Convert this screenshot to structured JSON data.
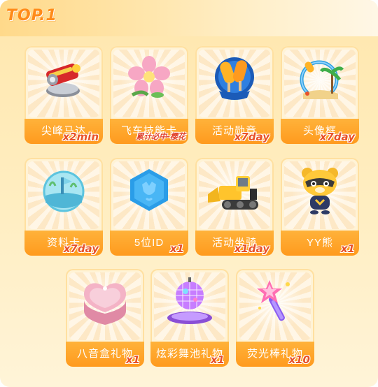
{
  "header": {
    "title": "TOP.1"
  },
  "rewards": [
    {
      "name": "尖峰马达",
      "qty": "x2min",
      "icon": "motor-icon"
    },
    {
      "name": "飞车技能卡",
      "qty": "累计必中-樱花",
      "icon": "cherry-blossom-icon"
    },
    {
      "name": "活动勋章",
      "qty": "x7day",
      "icon": "popsicle-medal-icon"
    },
    {
      "name": "头像框",
      "qty": "x7day",
      "icon": "beach-avatar-frame-icon"
    },
    {
      "name": "资料卡",
      "qty": "x7day",
      "icon": "profile-card-globe-icon"
    },
    {
      "name": "5位ID",
      "qty": "x1",
      "icon": "blue-hexagon-id-icon"
    },
    {
      "name": "活动坐骑",
      "qty": "x1day",
      "icon": "bulldozer-mount-icon"
    },
    {
      "name": "YY熊",
      "qty": "x1",
      "icon": "yy-bear-icon"
    },
    {
      "name": "八音盒礼物",
      "qty": "x1",
      "icon": "heart-music-box-icon"
    },
    {
      "name": "炫彩舞池礼物",
      "qty": "x1",
      "icon": "disco-ball-icon"
    },
    {
      "name": "荧光棒礼物",
      "qty": "x10",
      "icon": "glow-stick-icon"
    }
  ]
}
